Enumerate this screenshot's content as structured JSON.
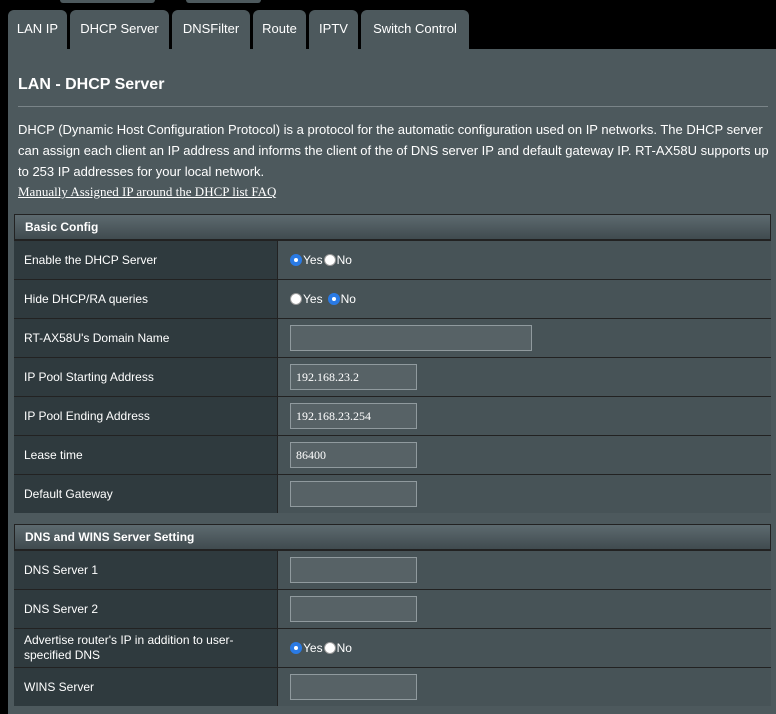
{
  "tabs": [
    {
      "label": "LAN IP",
      "active": false
    },
    {
      "label": "DHCP Server",
      "active": true
    },
    {
      "label": "DNSFilter",
      "active": false
    },
    {
      "label": "Route",
      "active": false
    },
    {
      "label": "IPTV",
      "active": false
    },
    {
      "label": "Switch Control",
      "active": false
    }
  ],
  "page": {
    "title": "LAN - DHCP Server",
    "description": "DHCP (Dynamic Host Configuration Protocol) is a protocol for the automatic configuration used on IP networks. The DHCP server can assign each client an IP address and informs the client of the of DNS server IP and default gateway IP. RT-AX58U supports up to 253 IP addresses for your local network.",
    "faq_link": "Manually Assigned IP around the DHCP list FAQ"
  },
  "basic_config": {
    "header": "Basic Config",
    "enable_dhcp": {
      "label": "Enable the DHCP Server",
      "yes": "Yes",
      "no": "No",
      "selected": "Yes"
    },
    "hide_dhcp_ra": {
      "label": "Hide DHCP/RA queries",
      "yes": "Yes",
      "no": "No",
      "selected": "No"
    },
    "domain_name": {
      "label": "RT-AX58U's Domain Name",
      "value": ""
    },
    "ip_pool_start": {
      "label": "IP Pool Starting Address",
      "value": "192.168.23.2"
    },
    "ip_pool_end": {
      "label": "IP Pool Ending Address",
      "value": "192.168.23.254"
    },
    "lease_time": {
      "label": "Lease time",
      "value": "86400"
    },
    "default_gateway": {
      "label": "Default Gateway",
      "value": ""
    }
  },
  "dns_wins": {
    "header": "DNS and WINS Server Setting",
    "dns1": {
      "label": "DNS Server 1",
      "value": ""
    },
    "dns2": {
      "label": "DNS Server 2",
      "value": ""
    },
    "advertise_router": {
      "label": "Advertise router's IP in addition to user-specified DNS",
      "yes": "Yes",
      "no": "No",
      "selected": "Yes"
    },
    "wins": {
      "label": "WINS Server",
      "value": ""
    }
  },
  "colors": {
    "panel": "#4d595d",
    "label_bg": "#2f3a3e",
    "value_bg": "#475357",
    "radio_checked": "#2a7ae4"
  }
}
